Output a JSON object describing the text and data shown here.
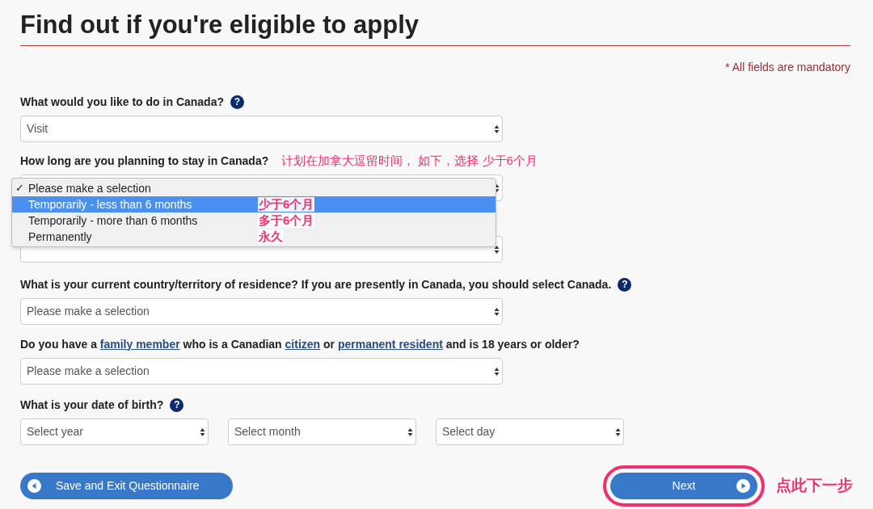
{
  "title": "Find out if you're eligible to apply",
  "mandatory_note": "* All fields are mandatory",
  "questions": [
    {
      "kind": "single",
      "label": [
        {
          "text": "What would you like to do in Canada?",
          "link": false
        }
      ],
      "help": "?",
      "selects": [
        "Visit"
      ]
    },
    {
      "kind": "single",
      "label": [
        {
          "text": "How long are you planning to stay in Canada?",
          "link": false
        }
      ],
      "annotation": "计划在加拿大逗留时间， 如下，选择 少于6个月"
    },
    {
      "kind": "single"
    },
    {
      "kind": "single",
      "label": [
        {
          "text": "What is your current country/territory of residence? If you are presently in Canada, you should select Canada.",
          "link": false
        }
      ],
      "help": "?",
      "selects": [
        "Please make a selection"
      ]
    },
    {
      "kind": "single",
      "label": [
        {
          "text": "Do you have a ",
          "link": false
        },
        {
          "text": "family member",
          "link": true
        },
        {
          "text": " who is a Canadian ",
          "link": false
        },
        {
          "text": "citizen",
          "link": true
        },
        {
          "text": " or ",
          "link": false
        },
        {
          "text": "permanent resident",
          "link": true
        },
        {
          "text": " and is 18 years or older?",
          "link": false
        }
      ],
      "selects": [
        "Please make a selection"
      ]
    },
    {
      "kind": "date",
      "label": [
        {
          "text": "What is your date of birth?",
          "link": false
        }
      ],
      "help": "?",
      "selects": [
        "Select year",
        "Select month",
        "Select day"
      ]
    }
  ],
  "dropdown": {
    "options": [
      {
        "label": "Please make a selection",
        "checked": true,
        "selected": false
      },
      {
        "label": "Temporarily - less than 6 months",
        "checked": false,
        "selected": true,
        "annotation": "少于6个月"
      },
      {
        "label": "Temporarily - more than 6 months",
        "checked": false,
        "selected": false,
        "annotation": "多于6个月"
      },
      {
        "label": "Permanently",
        "checked": false,
        "selected": false,
        "annotation": "永久"
      }
    ],
    "check": "✓"
  },
  "buttons": {
    "save": "Save and Exit Questionnaire",
    "next": "Next",
    "next_highlighted": true,
    "next_annotation": "点此下一步"
  }
}
